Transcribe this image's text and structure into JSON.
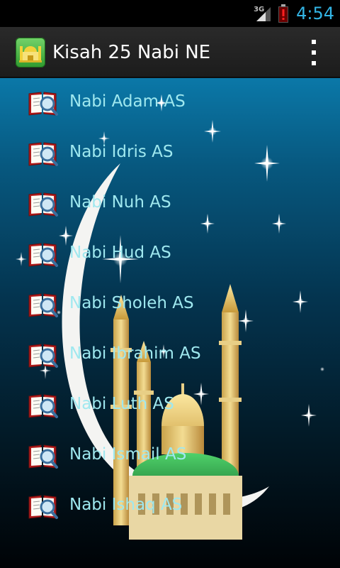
{
  "status_bar": {
    "network_label": "3G",
    "time": "4:54",
    "icons": [
      "signal-icon",
      "battery-alert-icon"
    ],
    "clock_color": "#33b5e5"
  },
  "action_bar": {
    "title": "Kisah 25 Nabi NE",
    "logo_icon": "mosque-logo-icon",
    "menu_icon": "overflow-menu-icon"
  },
  "list": {
    "item_icon": "book-magnifier-icon",
    "label_color": "#9fe8ef",
    "items": [
      {
        "label": "Nabi Adam AS"
      },
      {
        "label": "Nabi Idris AS"
      },
      {
        "label": "Nabi Nuh AS"
      },
      {
        "label": "Nabi Hud AS"
      },
      {
        "label": "Nabi Sholeh AS"
      },
      {
        "label": "Nabi Ibrahim AS"
      },
      {
        "label": "Nabi Luth AS"
      },
      {
        "label": "Nabi Ismail AS"
      },
      {
        "label": "Nabi Ishaq AS"
      }
    ]
  },
  "background": {
    "description_icons": [
      "crescent-moon-icon",
      "mosque-icon",
      "star-icon"
    ]
  }
}
